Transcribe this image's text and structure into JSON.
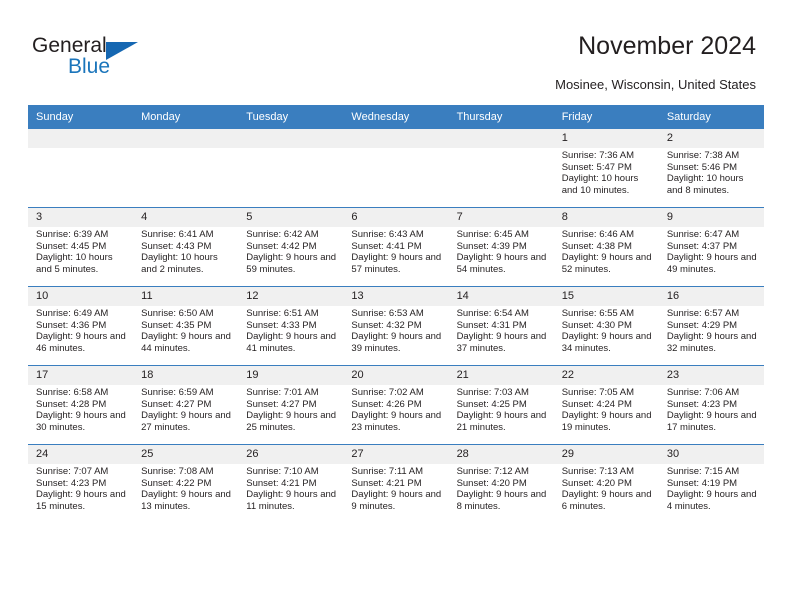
{
  "brand": {
    "name_part1": "General",
    "name_part2": "Blue",
    "triangle_color": "#1567b2",
    "blue_color": "#1b75bb"
  },
  "header": {
    "title": "November 2024",
    "subtitle": "Mosinee, Wisconsin, United States"
  },
  "theme": {
    "header_row_bg": "#3a7ebf",
    "daynum_bg": "#f0f0f0",
    "text_color": "#231f20"
  },
  "calendar": {
    "weekday_headers": [
      "Sunday",
      "Monday",
      "Tuesday",
      "Wednesday",
      "Thursday",
      "Friday",
      "Saturday"
    ],
    "weeks": [
      [
        {
          "empty": true
        },
        {
          "empty": true
        },
        {
          "empty": true
        },
        {
          "empty": true
        },
        {
          "empty": true
        },
        {
          "day": "1",
          "sunrise": "Sunrise: 7:36 AM",
          "sunset": "Sunset: 5:47 PM",
          "daylight": "Daylight: 10 hours and 10 minutes."
        },
        {
          "day": "2",
          "sunrise": "Sunrise: 7:38 AM",
          "sunset": "Sunset: 5:46 PM",
          "daylight": "Daylight: 10 hours and 8 minutes."
        }
      ],
      [
        {
          "day": "3",
          "sunrise": "Sunrise: 6:39 AM",
          "sunset": "Sunset: 4:45 PM",
          "daylight": "Daylight: 10 hours and 5 minutes."
        },
        {
          "day": "4",
          "sunrise": "Sunrise: 6:41 AM",
          "sunset": "Sunset: 4:43 PM",
          "daylight": "Daylight: 10 hours and 2 minutes."
        },
        {
          "day": "5",
          "sunrise": "Sunrise: 6:42 AM",
          "sunset": "Sunset: 4:42 PM",
          "daylight": "Daylight: 9 hours and 59 minutes."
        },
        {
          "day": "6",
          "sunrise": "Sunrise: 6:43 AM",
          "sunset": "Sunset: 4:41 PM",
          "daylight": "Daylight: 9 hours and 57 minutes."
        },
        {
          "day": "7",
          "sunrise": "Sunrise: 6:45 AM",
          "sunset": "Sunset: 4:39 PM",
          "daylight": "Daylight: 9 hours and 54 minutes."
        },
        {
          "day": "8",
          "sunrise": "Sunrise: 6:46 AM",
          "sunset": "Sunset: 4:38 PM",
          "daylight": "Daylight: 9 hours and 52 minutes."
        },
        {
          "day": "9",
          "sunrise": "Sunrise: 6:47 AM",
          "sunset": "Sunset: 4:37 PM",
          "daylight": "Daylight: 9 hours and 49 minutes."
        }
      ],
      [
        {
          "day": "10",
          "sunrise": "Sunrise: 6:49 AM",
          "sunset": "Sunset: 4:36 PM",
          "daylight": "Daylight: 9 hours and 46 minutes."
        },
        {
          "day": "11",
          "sunrise": "Sunrise: 6:50 AM",
          "sunset": "Sunset: 4:35 PM",
          "daylight": "Daylight: 9 hours and 44 minutes."
        },
        {
          "day": "12",
          "sunrise": "Sunrise: 6:51 AM",
          "sunset": "Sunset: 4:33 PM",
          "daylight": "Daylight: 9 hours and 41 minutes."
        },
        {
          "day": "13",
          "sunrise": "Sunrise: 6:53 AM",
          "sunset": "Sunset: 4:32 PM",
          "daylight": "Daylight: 9 hours and 39 minutes."
        },
        {
          "day": "14",
          "sunrise": "Sunrise: 6:54 AM",
          "sunset": "Sunset: 4:31 PM",
          "daylight": "Daylight: 9 hours and 37 minutes."
        },
        {
          "day": "15",
          "sunrise": "Sunrise: 6:55 AM",
          "sunset": "Sunset: 4:30 PM",
          "daylight": "Daylight: 9 hours and 34 minutes."
        },
        {
          "day": "16",
          "sunrise": "Sunrise: 6:57 AM",
          "sunset": "Sunset: 4:29 PM",
          "daylight": "Daylight: 9 hours and 32 minutes."
        }
      ],
      [
        {
          "day": "17",
          "sunrise": "Sunrise: 6:58 AM",
          "sunset": "Sunset: 4:28 PM",
          "daylight": "Daylight: 9 hours and 30 minutes."
        },
        {
          "day": "18",
          "sunrise": "Sunrise: 6:59 AM",
          "sunset": "Sunset: 4:27 PM",
          "daylight": "Daylight: 9 hours and 27 minutes."
        },
        {
          "day": "19",
          "sunrise": "Sunrise: 7:01 AM",
          "sunset": "Sunset: 4:27 PM",
          "daylight": "Daylight: 9 hours and 25 minutes."
        },
        {
          "day": "20",
          "sunrise": "Sunrise: 7:02 AM",
          "sunset": "Sunset: 4:26 PM",
          "daylight": "Daylight: 9 hours and 23 minutes."
        },
        {
          "day": "21",
          "sunrise": "Sunrise: 7:03 AM",
          "sunset": "Sunset: 4:25 PM",
          "daylight": "Daylight: 9 hours and 21 minutes."
        },
        {
          "day": "22",
          "sunrise": "Sunrise: 7:05 AM",
          "sunset": "Sunset: 4:24 PM",
          "daylight": "Daylight: 9 hours and 19 minutes."
        },
        {
          "day": "23",
          "sunrise": "Sunrise: 7:06 AM",
          "sunset": "Sunset: 4:23 PM",
          "daylight": "Daylight: 9 hours and 17 minutes."
        }
      ],
      [
        {
          "day": "24",
          "sunrise": "Sunrise: 7:07 AM",
          "sunset": "Sunset: 4:23 PM",
          "daylight": "Daylight: 9 hours and 15 minutes."
        },
        {
          "day": "25",
          "sunrise": "Sunrise: 7:08 AM",
          "sunset": "Sunset: 4:22 PM",
          "daylight": "Daylight: 9 hours and 13 minutes."
        },
        {
          "day": "26",
          "sunrise": "Sunrise: 7:10 AM",
          "sunset": "Sunset: 4:21 PM",
          "daylight": "Daylight: 9 hours and 11 minutes."
        },
        {
          "day": "27",
          "sunrise": "Sunrise: 7:11 AM",
          "sunset": "Sunset: 4:21 PM",
          "daylight": "Daylight: 9 hours and 9 minutes."
        },
        {
          "day": "28",
          "sunrise": "Sunrise: 7:12 AM",
          "sunset": "Sunset: 4:20 PM",
          "daylight": "Daylight: 9 hours and 8 minutes."
        },
        {
          "day": "29",
          "sunrise": "Sunrise: 7:13 AM",
          "sunset": "Sunset: 4:20 PM",
          "daylight": "Daylight: 9 hours and 6 minutes."
        },
        {
          "day": "30",
          "sunrise": "Sunrise: 7:15 AM",
          "sunset": "Sunset: 4:19 PM",
          "daylight": "Daylight: 9 hours and 4 minutes."
        }
      ]
    ]
  }
}
